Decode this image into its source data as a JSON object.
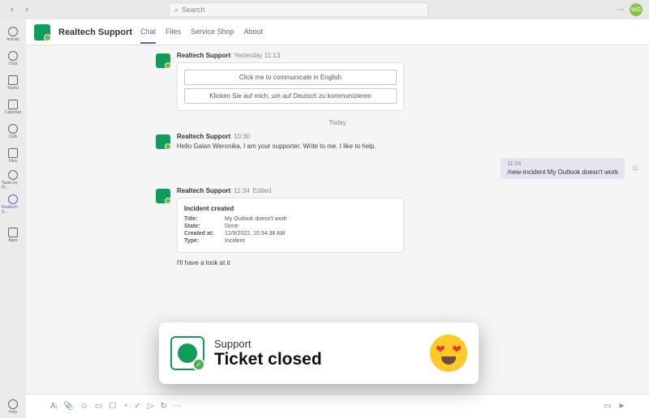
{
  "titlebar": {
    "search_placeholder": "Search",
    "avatar_initials": "WG"
  },
  "rail": [
    {
      "label": "Activity"
    },
    {
      "label": "Chat"
    },
    {
      "label": "Teams"
    },
    {
      "label": "Calendar"
    },
    {
      "label": "Calls"
    },
    {
      "label": "Files"
    },
    {
      "label": "Tasks by Pl..."
    },
    {
      "label": "Realtech S..."
    },
    {
      "label": "Apps"
    }
  ],
  "rail_help": "Help",
  "header": {
    "title": "Realtech Support",
    "tabs": [
      "Chat",
      "Files",
      "Service Shop",
      "About"
    ]
  },
  "messages": {
    "m1": {
      "sender": "Realtech Support",
      "time": "Yesterday 11:13",
      "btn_en": "Click me to communicate in English",
      "btn_de": "Klicken Sie auf mich, um auf Deutsch zu kommunizieren"
    },
    "day_separator": "Today",
    "m2": {
      "sender": "Realtech Support",
      "time": "10:30",
      "text": "Hello Galan Weronika, I am your supporter. Write to me. I like to help."
    },
    "my1": {
      "time": "11:04",
      "text": "/new-incident My Outlook doesn't work"
    },
    "m3": {
      "sender": "Realtech Support",
      "time": "11:34",
      "edited": "Edited",
      "incident": {
        "heading": "Incident created",
        "rows": [
          {
            "label": "Title:",
            "value": "My Outlook doesn't work"
          },
          {
            "label": "State:",
            "value": "Done"
          },
          {
            "label": "Created at:",
            "value": "12/9/2022, 10:34:38 AM"
          },
          {
            "label": "Type:",
            "value": "Incident"
          }
        ]
      },
      "followup": "I'll have a look at it"
    }
  },
  "notification": {
    "subtitle": "Support",
    "title": "Ticket closed"
  }
}
